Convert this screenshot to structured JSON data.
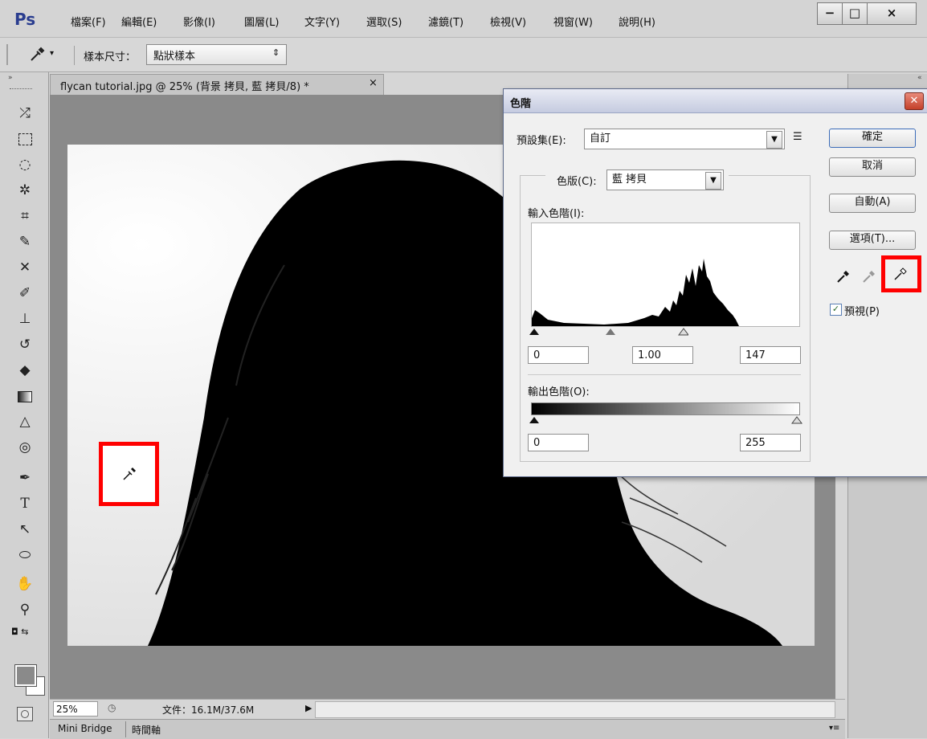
{
  "app": {
    "logo": "Ps"
  },
  "menu": [
    "檔案(F)",
    "編輯(E)",
    "影像(I)",
    "圖層(L)",
    "文字(Y)",
    "選取(S)",
    "濾鏡(T)",
    "檢視(V)",
    "視窗(W)",
    "說明(H)"
  ],
  "window_controls": {
    "minimize": "−",
    "maximize": "□",
    "close": "×"
  },
  "options_bar": {
    "sample_size_label": "樣本尺寸：",
    "sample_size_value": "點狀樣本",
    "select_arrow": "⇕"
  },
  "document_tab": {
    "title": "flycan tutorial.jpg @ 25% (背景 拷貝, 藍 拷貝/8) *",
    "close": "×"
  },
  "toolbar": {
    "tools": [
      "move-tool",
      "marquee-tool",
      "lasso-tool",
      "quick-select-tool",
      "crop-tool",
      "eyedropper-tool",
      "healing-tool",
      "brush-tool",
      "stamp-tool",
      "history-brush-tool",
      "eraser-tool",
      "gradient-tool",
      "blur-tool",
      "dodge-tool",
      "pen-tool",
      "type-tool",
      "path-select-tool",
      "shape-tool",
      "hand-tool",
      "zoom-tool"
    ]
  },
  "status": {
    "zoom": "25%",
    "doc_info": "文件：16.1M/37.6M",
    "arrow": "▶"
  },
  "bottom_tabs": [
    "Mini Bridge",
    "時間軸"
  ],
  "levels_dialog": {
    "title": "色階",
    "preset_label": "預設集(E):",
    "preset_value": "自訂",
    "channel_label": "色版(C):",
    "channel_value": "藍 拷貝",
    "input_levels_label": "輸入色階(I):",
    "input_black": "0",
    "input_gamma": "1.00",
    "input_white": "147",
    "output_levels_label": "輸出色階(O):",
    "output_black": "0",
    "output_white": "255",
    "buttons": {
      "ok": "確定",
      "cancel": "取消",
      "auto": "自動(A)",
      "options": "選項(T)..."
    },
    "preview_label": "預視(P)",
    "preview_checked": true
  },
  "colors": {
    "highlight_red": "#ff0000",
    "ps_blue": "#2a3d8f",
    "button_border": "#3c6cb8"
  }
}
